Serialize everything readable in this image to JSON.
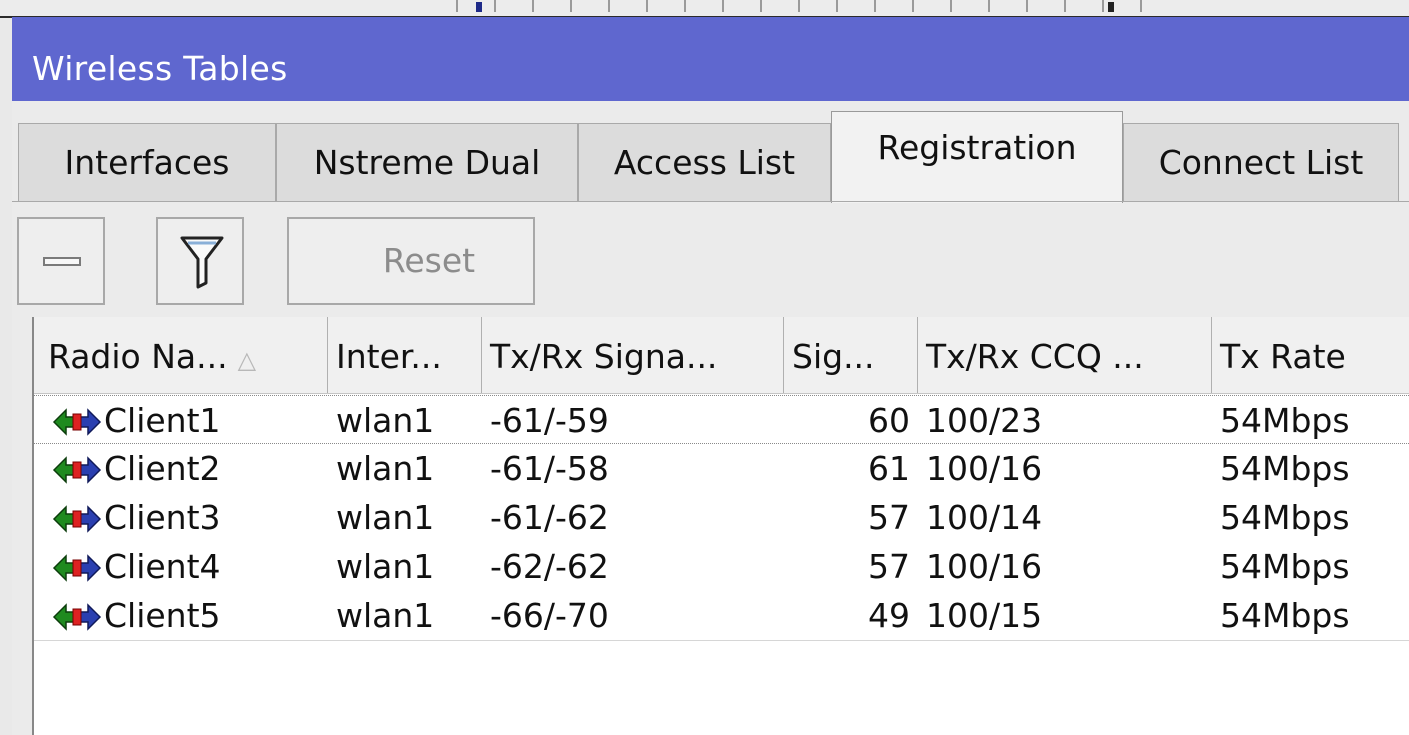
{
  "window": {
    "title": "Wireless Tables"
  },
  "tabs": [
    {
      "label": "Interfaces",
      "active": false
    },
    {
      "label": "Nstreme Dual",
      "active": false
    },
    {
      "label": "Access List",
      "active": false
    },
    {
      "label": "Registration",
      "active": true
    },
    {
      "label": "Connect List",
      "active": false
    }
  ],
  "toolbar": {
    "remove_icon": "minus-icon",
    "filter_icon": "filter-icon",
    "reset_label": "Reset"
  },
  "table": {
    "sort_indicator": "△",
    "columns": [
      "Radio Na...",
      "Inter...",
      "Tx/Rx Signa...",
      "Sig...",
      "Tx/Rx CCQ ...",
      "Tx Rate"
    ],
    "rows": [
      {
        "radio_name": "Client1",
        "interface": "wlan1",
        "signal": "-61/-59",
        "sig": "60",
        "ccq": "100/23",
        "tx_rate": "54Mbps"
      },
      {
        "radio_name": "Client2",
        "interface": "wlan1",
        "signal": "-61/-58",
        "sig": "61",
        "ccq": "100/16",
        "tx_rate": "54Mbps"
      },
      {
        "radio_name": "Client3",
        "interface": "wlan1",
        "signal": "-61/-62",
        "sig": "57",
        "ccq": "100/14",
        "tx_rate": "54Mbps"
      },
      {
        "radio_name": "Client4",
        "interface": "wlan1",
        "signal": "-62/-62",
        "sig": "57",
        "ccq": "100/16",
        "tx_rate": "54Mbps"
      },
      {
        "radio_name": "Client5",
        "interface": "wlan1",
        "signal": "-66/-70",
        "sig": "49",
        "ccq": "100/15",
        "tx_rate": "54Mbps"
      }
    ],
    "row_icon": "wireless-link-icon"
  },
  "colors": {
    "titlebar": "#5f67cf",
    "title_text": "#ffffff",
    "icon_green": "#1f8a1f",
    "icon_blue": "#2a3fb0"
  }
}
